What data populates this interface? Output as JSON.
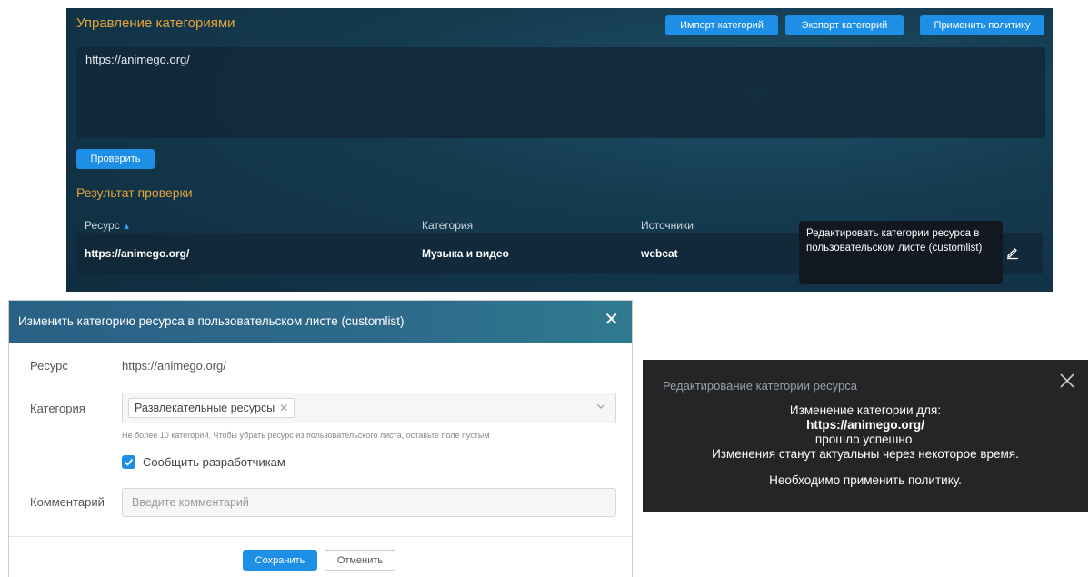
{
  "top": {
    "title": "Управление категориями",
    "buttons": {
      "import": "Импорт категорий",
      "export": "Экспорт категорий",
      "apply": "Применить политику"
    },
    "url_text": "https://animego.org/",
    "check_button": "Проверить",
    "result_title": "Результат проверки",
    "columns": {
      "resource": "Ресурс",
      "category": "Категория",
      "sources": "Источники"
    },
    "row": {
      "resource": "https://animego.org/",
      "category": "Музыка и видео",
      "sources": "webcat"
    },
    "tooltip": "Редактировать категории ресурса в пользовательском листе (customlist)"
  },
  "dialog": {
    "title": "Изменить категорию ресурса в пользовательском листе (customlist)",
    "resource_label": "Ресурс",
    "resource_value": "https://animego.org/",
    "category_label": "Категория",
    "category_tag": "Развлекательные ресурсы",
    "hint": "Не более 10 категорий. Чтобы убрать ресурс из пользовательского листа, оставьте поле пустым",
    "notify_devs_label": "Сообщить разработчикам",
    "notify_devs_checked": true,
    "comment_label": "Комментарий",
    "comment_placeholder": "Введите комментарий",
    "save_button": "Сохранить",
    "cancel_button": "Отменить"
  },
  "notification": {
    "title": "Редактирование категории ресурса",
    "line1": "Изменение категории для:",
    "line2": "https://animego.org/",
    "line3": "прошло успешно.",
    "line4": "Изменения станут актуальны через некоторое время.",
    "line5": "Необходимо применить политику."
  },
  "colors": {
    "accent": "#1e8fe6",
    "heading_orange": "#e3a33a"
  }
}
